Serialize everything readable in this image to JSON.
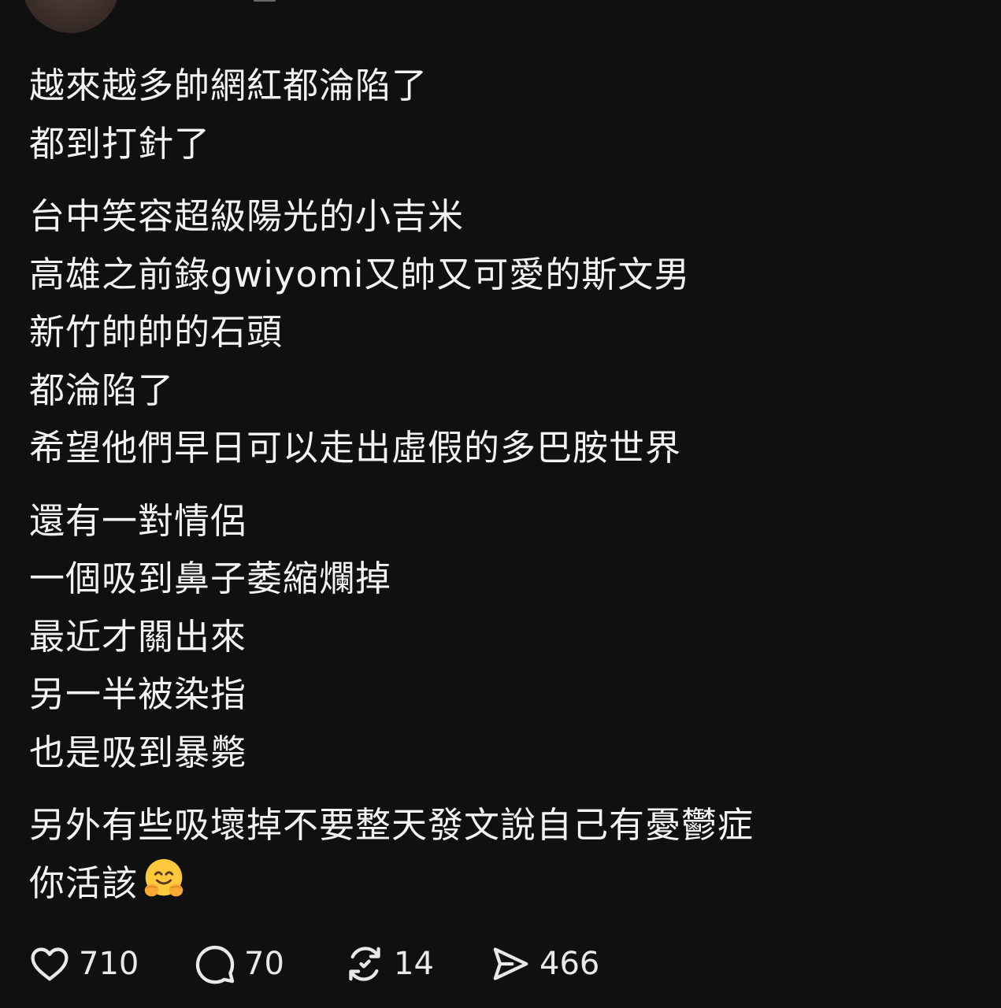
{
  "post": {
    "paragraphs": [
      {
        "lines": [
          "越來越多帥網紅都淪陷了",
          "都到打針了"
        ]
      },
      {
        "lines": [
          "台中笑容超級陽光的小吉米",
          "高雄之前錄gwiyomi又帥又可愛的斯文男",
          "新竹帥帥的石頭",
          "都淪陷了",
          "希望他們早日可以走出虛假的多巴胺世界"
        ]
      },
      {
        "lines": [
          "還有一對情侶",
          "一個吸到鼻子萎縮爛掉",
          "最近才關出來",
          "另一半被染指",
          "也是吸到暴斃"
        ]
      },
      {
        "lines": [
          "另外有些吸壞掉不要整天發文說自己有憂鬱症",
          "你活該"
        ]
      }
    ],
    "trailing_emoji": "hugging-face-emoji"
  },
  "actions": {
    "like": {
      "icon": "heart-icon",
      "count": "710"
    },
    "reply": {
      "icon": "comment-icon",
      "count": "70"
    },
    "repost": {
      "icon": "repost-icon",
      "count": "14"
    },
    "share": {
      "icon": "send-icon",
      "count": "466"
    }
  },
  "colors": {
    "background": "#101010",
    "text": "#f3f3f3",
    "icon": "#e9e9e9"
  }
}
